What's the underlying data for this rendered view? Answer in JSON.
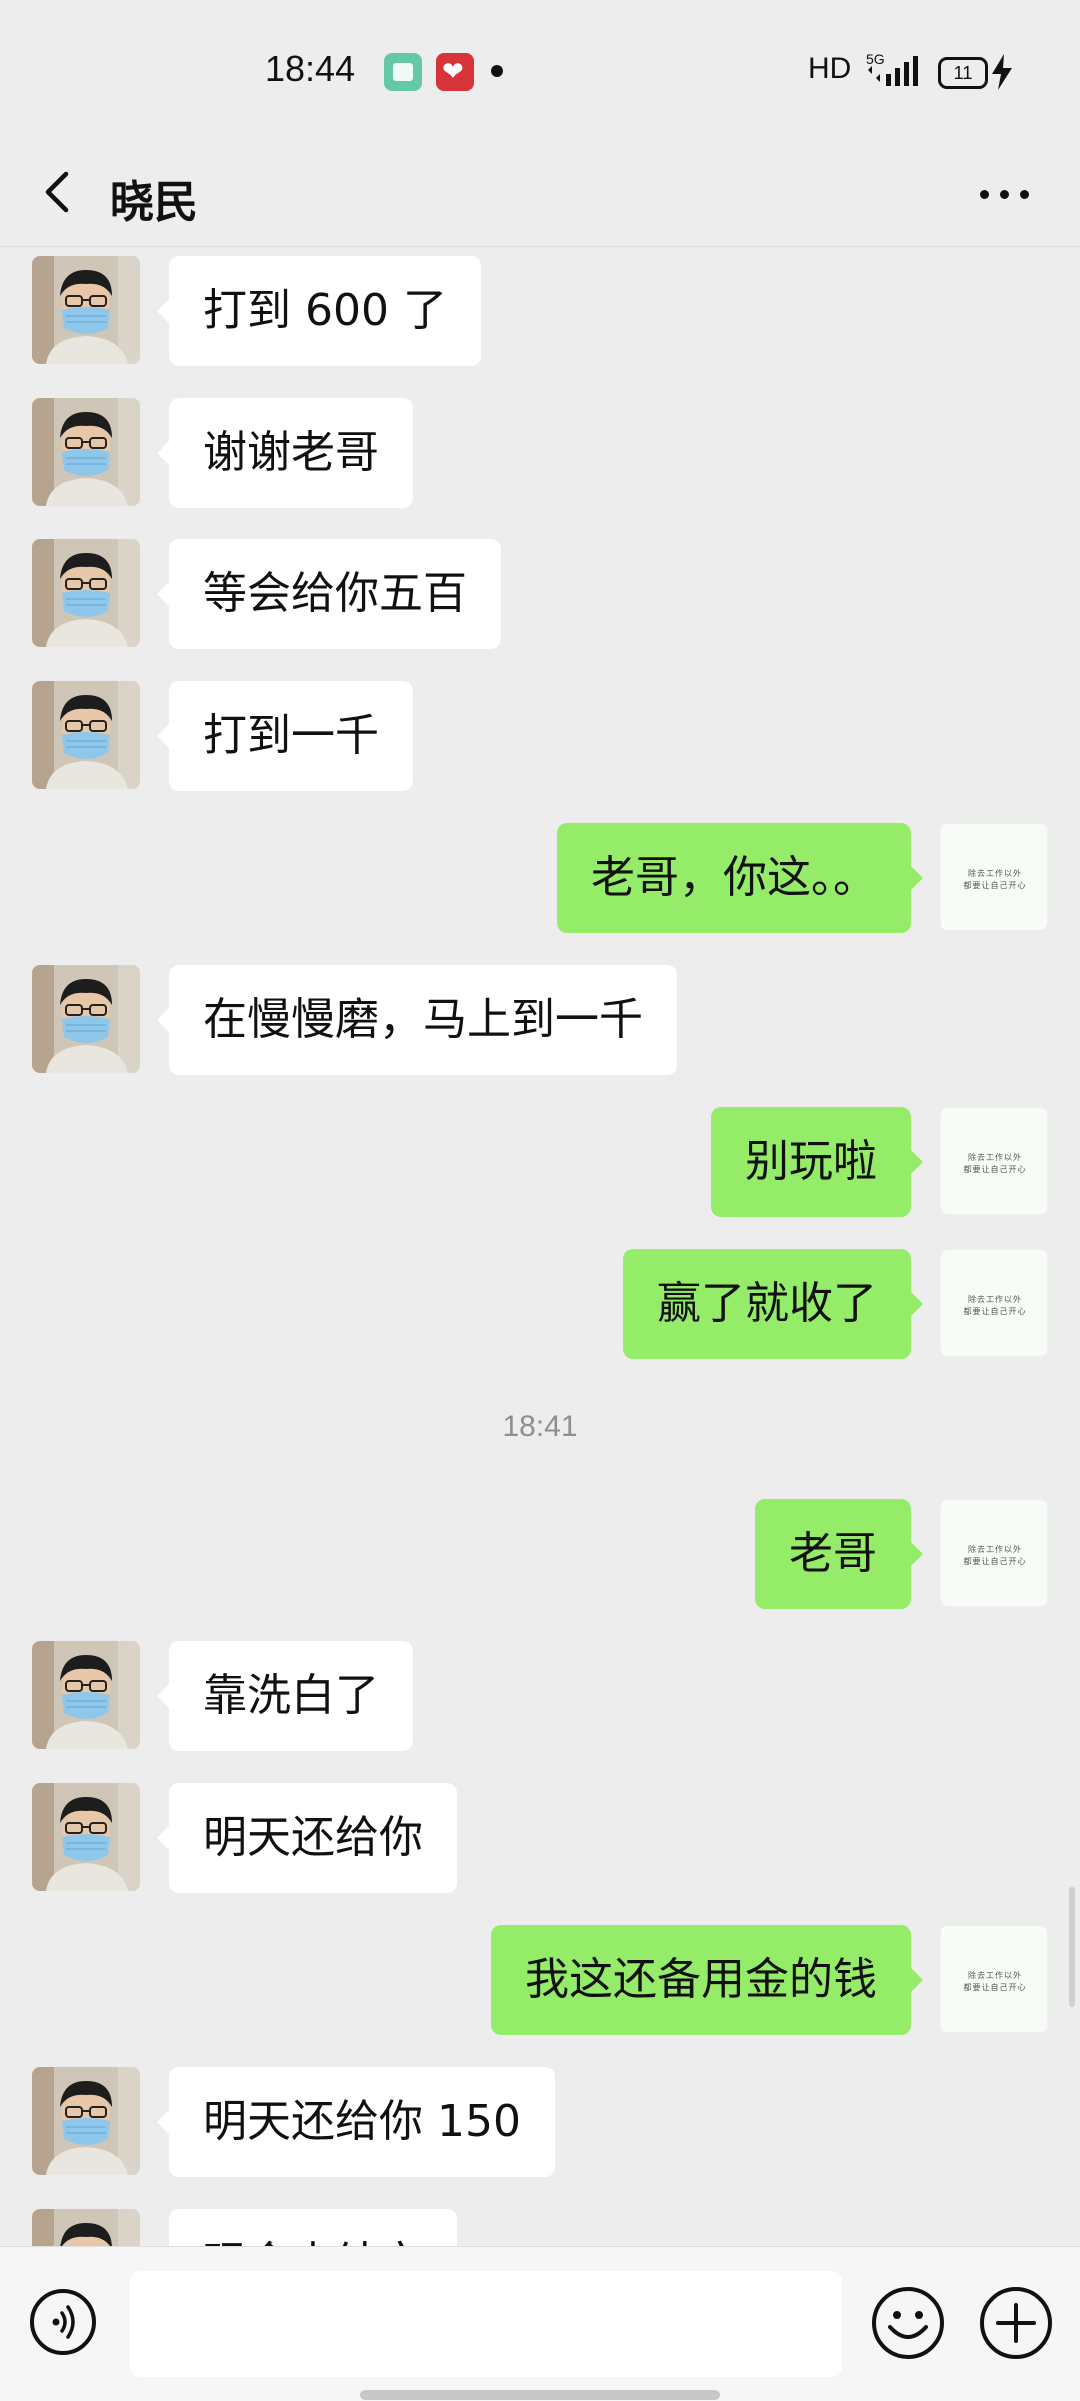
{
  "status_bar": {
    "time": "18:44",
    "network_label": "HD",
    "network_type": "5G",
    "battery": "11",
    "icons": [
      "app-notification-icon",
      "heart-app-icon",
      "notification-dot-icon",
      "signal-icon",
      "battery-icon",
      "charging-icon"
    ]
  },
  "header": {
    "title": "晓民",
    "back_icon": "chevron-left-icon",
    "more_icon": "more-dots-icon"
  },
  "my_avatar": {
    "line1": "除去工作以外",
    "line2": "都要让自己开心"
  },
  "messages": [
    {
      "side": "left",
      "text": "打到 600 了"
    },
    {
      "side": "left",
      "text": "谢谢老哥"
    },
    {
      "side": "left",
      "text": "等会给你五百"
    },
    {
      "side": "left",
      "text": "打到一千"
    },
    {
      "side": "right",
      "text": "老哥，你这。。"
    },
    {
      "side": "left",
      "text": "在慢慢磨，马上到一千"
    },
    {
      "side": "right",
      "text": "别玩啦"
    },
    {
      "side": "right",
      "text": "赢了就收了"
    },
    {
      "side": "time",
      "text": "18:41"
    },
    {
      "side": "right",
      "text": "老哥"
    },
    {
      "side": "left",
      "text": "靠洗白了"
    },
    {
      "side": "left",
      "text": "明天还给你"
    },
    {
      "side": "right",
      "text": "我这还备用金的钱"
    },
    {
      "side": "left",
      "text": "明天还给你 150"
    },
    {
      "side": "left",
      "text": "现金未结完"
    }
  ],
  "input_bar": {
    "value": "",
    "voice_icon": "voice-icon",
    "emoji_icon": "emoji-icon",
    "plus_icon": "plus-icon"
  },
  "colors": {
    "background": "#ededed",
    "my_bubble": "#95ec69",
    "their_bubble": "#ffffff",
    "timestamp": "#8f8f8f"
  }
}
